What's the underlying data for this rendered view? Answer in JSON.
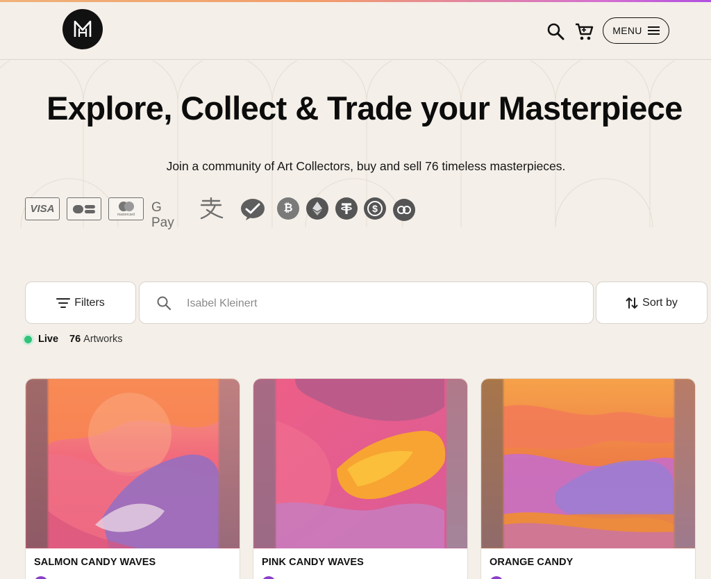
{
  "header": {
    "logo_alt": "M",
    "menu_label": "MENU"
  },
  "hero": {
    "title": "Explore, Collect & Trade your Masterpiece",
    "subtitle": "Join a community of Art Collectors, buy and sell 76 timeless masterpieces."
  },
  "payments": {
    "items": [
      "visa-icon",
      "cb-card-icon",
      "mastercard-icon",
      "google-pay-icon",
      "alipay-icon",
      "wechat-pay-icon",
      "bitcoin-icon",
      "ethereum-icon",
      "tether-icon",
      "usdc-icon",
      "polygon-icon"
    ],
    "visa_label": "VISA",
    "gpay_label": "G Pay",
    "mastercard_label": "mastercard"
  },
  "toolbar": {
    "filters_label": "Filters",
    "search_value": "Isabel Kleinert",
    "sort_label": "Sort by"
  },
  "status": {
    "live_label": "Live",
    "count": "76",
    "count_suffix": "Artworks"
  },
  "artworks": [
    {
      "title": "SALMON CANDY WAVES"
    },
    {
      "title": "PINK CANDY WAVES"
    },
    {
      "title": "ORANGE CANDY"
    }
  ],
  "colors": {
    "background": "#f4efe8",
    "live_green": "#33c27a",
    "top_gradient_start": "#f0b27a",
    "top_gradient_end": "#b04fe0",
    "avatar_purple": "#8a3ec8"
  }
}
